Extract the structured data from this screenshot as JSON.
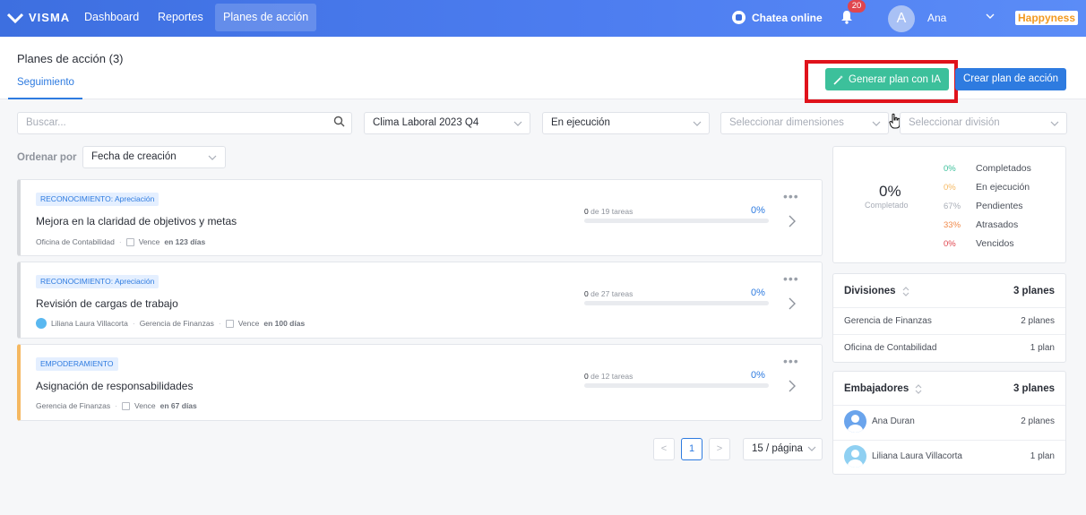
{
  "topbar": {
    "logo_text": "VISMA",
    "nav": [
      {
        "label": "Dashboard"
      },
      {
        "label": "Reportes"
      },
      {
        "label": "Planes de acción",
        "active": true
      }
    ],
    "chat_label": "Chatea online",
    "notifications_count": "20",
    "avatar_letter": "A",
    "user_name": "Ana",
    "brand_badge": "Happyness",
    "accent_color": "#3d6fe0"
  },
  "header": {
    "title": "Planes de acción (3)",
    "tab": "Seguimiento",
    "ai_button": "Generar plan con IA",
    "create_button": "Crear plan de acción"
  },
  "filters": {
    "search_placeholder": "Buscar...",
    "survey": "Clima Laboral 2023 Q4",
    "status": "En ejecución",
    "dimensions_placeholder": "Seleccionar dimensiones",
    "division_placeholder": "Seleccionar división",
    "order_label": "Ordenar por",
    "order_value": "Fecha de creación"
  },
  "plans": [
    {
      "tag": "RECONOCIMIENTO: Apreciación",
      "title": "Mejora en la claridad de objetivos y metas",
      "owner": "",
      "division": "Oficina de Contabilidad",
      "due_prefix": "Vence",
      "due_value": "en 123 días",
      "tasks_done": "0",
      "tasks_text": "de 19 tareas",
      "progress_label": "0%",
      "progress": 0
    },
    {
      "tag": "RECONOCIMIENTO: Apreciación",
      "title": "Revisión de cargas de trabajo",
      "owner": "Liliana Laura Villacorta",
      "division": "Gerencia de Finanzas",
      "due_prefix": "Vence",
      "due_value": "en 100 días",
      "tasks_done": "0",
      "tasks_text": "de 27 tareas",
      "progress_label": "0%",
      "progress": 0
    },
    {
      "tag": "EMPODERAMIENTO",
      "title": "Asignación de responsabilidades",
      "owner": "",
      "division": "Gerencia de Finanzas",
      "due_prefix": "Vence",
      "due_value": "en 67 días",
      "tasks_done": "0",
      "tasks_text": "de 12 tareas",
      "progress_label": "0%",
      "progress": 0
    }
  ],
  "pagination": {
    "prev": "<",
    "current": "1",
    "next": ">",
    "page_size": "15 / página"
  },
  "summary": {
    "completed_pct": "0%",
    "completed_label": "Completado",
    "stats": [
      {
        "pct": "0%",
        "label": "Completados",
        "color": "#3cc09b"
      },
      {
        "pct": "0%",
        "label": "En ejecución",
        "color": "#f5b861"
      },
      {
        "pct": "67%",
        "label": "Pendientes",
        "color": "#a8adb7"
      },
      {
        "pct": "33%",
        "label": "Atrasados",
        "color": "#f08a4b"
      },
      {
        "pct": "0%",
        "label": "Vencidos",
        "color": "#e0454e"
      }
    ]
  },
  "divisions": {
    "title": "Divisiones",
    "total": "3 planes",
    "rows": [
      {
        "name": "Gerencia de Finanzas",
        "count": "2 planes"
      },
      {
        "name": "Oficina de Contabilidad",
        "count": "1 plan"
      }
    ]
  },
  "ambassadors": {
    "title": "Embajadores",
    "total": "3 planes",
    "rows": [
      {
        "name": "Ana Duran",
        "count": "2 planes"
      },
      {
        "name": "Liliana Laura Villacorta",
        "count": "1 plan"
      }
    ]
  }
}
